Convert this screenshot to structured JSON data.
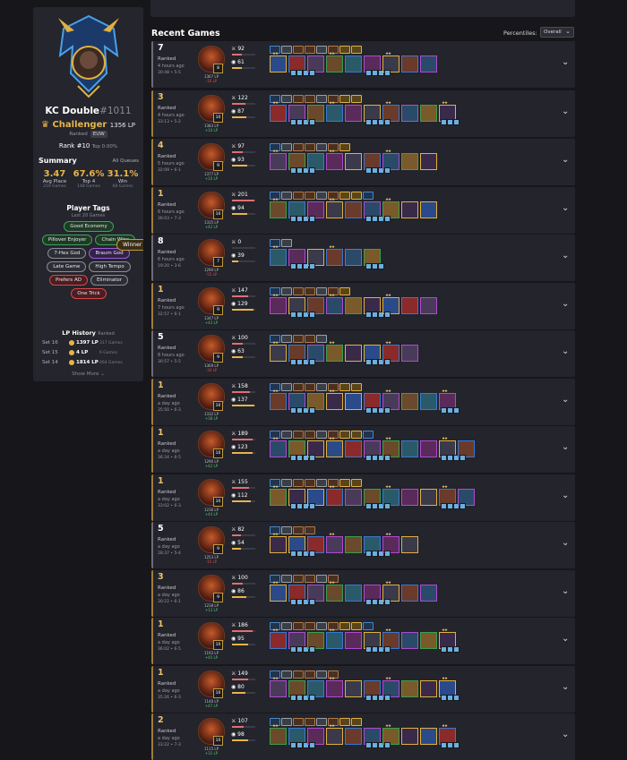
{
  "profile": {
    "name": "KC Double",
    "tag": "#1011",
    "tier": "Challenger",
    "lp": "1356 LP",
    "queue": "Ranked",
    "region": "EUW",
    "rank": "Rank #10",
    "top": "Top 0.00%"
  },
  "summary": {
    "title": "Summary",
    "queue": "All Queues",
    "stats": [
      {
        "value": "3.47",
        "label": "Avg Place",
        "sub": "219 Games"
      },
      {
        "value": "67.6%",
        "label": "Top 4",
        "sub": "148 Games"
      },
      {
        "value": "31.1%",
        "label": "Win",
        "sub": "68 Games"
      }
    ]
  },
  "player_tags": {
    "title": "Player Tags",
    "subtitle": "Last 20 Games",
    "tags": [
      {
        "label": "Good Economy",
        "style": "green"
      },
      {
        "label": "Pillover Enjoyer",
        "style": "green"
      },
      {
        "label": "Chain Wins",
        "style": "green"
      },
      {
        "label": "7-Hex God",
        "style": "gray"
      },
      {
        "label": "Braum God",
        "style": "purple"
      },
      {
        "label": "Winner",
        "style": "gold"
      },
      {
        "label": "Late Game",
        "style": "gray"
      },
      {
        "label": "High Tempo",
        "style": "gray"
      },
      {
        "label": "Prefers AD",
        "style": "red"
      },
      {
        "label": "Eliminator",
        "style": "gray"
      },
      {
        "label": "One Trick",
        "style": "red"
      }
    ]
  },
  "lp_history": {
    "title": "LP History",
    "queue": "Ranked",
    "rows": [
      {
        "set": "Set 16",
        "lp": "1397 LP",
        "games": "317 Games"
      },
      {
        "set": "Set 15",
        "lp": "4 LP",
        "games": "6 Games"
      },
      {
        "set": "Set 14",
        "lp": "1814 LP",
        "games": "464 Games"
      }
    ],
    "show_more": "Show More"
  },
  "recent": {
    "title": "Recent Games",
    "percentiles_label": "Percentiles:",
    "percentiles_value": "Overall"
  },
  "colors": {
    "accent": "#e8b44a",
    "win": "#52c46b",
    "loss": "#e24b4b",
    "panel": "#24252d"
  },
  "games": [
    {
      "place": "7",
      "queue": "Ranked",
      "time": "4 hours ago",
      "dur": "30:48 • 5-5",
      "level": "8",
      "lp": "1367 LP",
      "delta": "-16 LP",
      "dmg": "92",
      "gold": "61"
    },
    {
      "place": "3",
      "queue": "Ranked",
      "time": "4 hours ago",
      "dur": "33:13 • 5-2",
      "level": "10",
      "lp": "1383 LP",
      "delta": "+10 LP",
      "dmg": "122",
      "gold": "87"
    },
    {
      "place": "4",
      "queue": "Ranked",
      "time": "5 hours ago",
      "dur": "32:09 • 6-1",
      "level": "9",
      "lp": "1377 LP",
      "delta": "+10 LP",
      "dmg": "97",
      "gold": "93"
    },
    {
      "place": "1",
      "queue": "Ranked",
      "time": "6 hours ago",
      "dur": "36:03 • 7-3",
      "level": "10",
      "lp": "1335 LP",
      "delta": "+42 LP",
      "dmg": "201",
      "gold": "94"
    },
    {
      "place": "8",
      "queue": "Ranked",
      "time": "6 hours ago",
      "dur": "19:20 • 3-6",
      "level": "7",
      "lp": "1290 LP",
      "delta": "-55 LP",
      "dmg": "0",
      "gold": "39"
    },
    {
      "place": "1",
      "queue": "Ranked",
      "time": "7 hours ago",
      "dur": "32:57 • 6-1",
      "level": "9",
      "lp": "1347 LP",
      "delta": "+43 LP",
      "dmg": "147",
      "gold": "129"
    },
    {
      "place": "5",
      "queue": "Ranked",
      "time": "8 hours ago",
      "dur": "30:57 • 5-5",
      "level": "9",
      "lp": "1369 LP",
      "delta": "-34 LP",
      "dmg": "100",
      "gold": "63"
    },
    {
      "place": "1",
      "queue": "Ranked",
      "time": "a day ago",
      "dur": "35:50 • 6-3",
      "level": "10",
      "lp": "1332 LP",
      "delta": "+38 LP",
      "dmg": "158",
      "gold": "137"
    },
    {
      "place": "1",
      "queue": "Ranked",
      "time": "a day ago",
      "dur": "36:34 • 6-5",
      "level": "10",
      "lp": "1290 LP",
      "delta": "+42 LP",
      "dmg": "189",
      "gold": "123"
    },
    {
      "place": "1",
      "queue": "Ranked",
      "time": "a day ago",
      "dur": "33:02 • 6-3",
      "level": "10",
      "lp": "1236 LP",
      "delta": "+44 LP",
      "dmg": "155",
      "gold": "112"
    },
    {
      "place": "5",
      "queue": "Ranked",
      "time": "a day ago",
      "dur": "28:37 • 5-4",
      "level": "9",
      "lp": "1253 LP",
      "delta": "-15 LP",
      "dmg": "82",
      "gold": "54"
    },
    {
      "place": "3",
      "queue": "Ranked",
      "time": "a day ago",
      "dur": "30:22 • 6-1",
      "level": "9",
      "lp": "1238 LP",
      "delta": "+13 LP",
      "dmg": "100",
      "gold": "86"
    },
    {
      "place": "1",
      "queue": "Ranked",
      "time": "a day ago",
      "dur": "36:02 • 6-5",
      "level": "10",
      "lp": "1193 LP",
      "delta": "+45 LP",
      "dmg": "186",
      "gold": "95"
    },
    {
      "place": "1",
      "queue": "Ranked",
      "time": "a day ago",
      "dur": "35:26 • 6-3",
      "level": "10",
      "lp": "1146 LP",
      "delta": "+47 LP",
      "dmg": "149",
      "gold": "80"
    },
    {
      "place": "2",
      "queue": "Ranked",
      "time": "a day ago",
      "dur": "33:22 • 7-3",
      "level": "10",
      "lp": "1115 LP",
      "delta": "+31 LP",
      "dmg": "107",
      "gold": "98"
    }
  ]
}
